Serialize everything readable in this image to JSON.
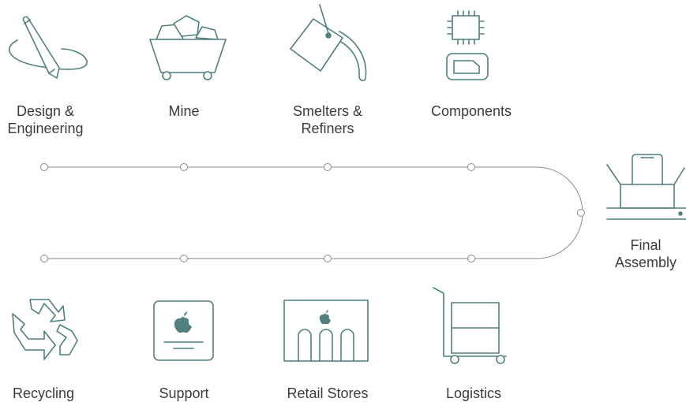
{
  "colors": {
    "icon_stroke": "#4f7f7f",
    "icon_fill": "#ffffff",
    "line": "#8a8a8a",
    "node_fill": "#ffffff",
    "text": "#3b3b3b"
  },
  "stages": {
    "design": {
      "line1": "Design &",
      "line2": "Engineering",
      "icon": "pencil-icon"
    },
    "mine": {
      "label": "Mine",
      "icon": "mine-cart-icon"
    },
    "smelters": {
      "line1": "Smelters &",
      "line2": "Refiners",
      "icon": "crucible-icon"
    },
    "components": {
      "label": "Components",
      "icon": "chip-icon"
    },
    "final": {
      "line1": "Final",
      "line2": "Assembly",
      "icon": "assembly-box-icon"
    },
    "recycling": {
      "label": "Recycling",
      "icon": "recycle-icon"
    },
    "support": {
      "label": "Support",
      "icon": "support-device-icon"
    },
    "retail": {
      "label": "Retail Stores",
      "icon": "store-icon"
    },
    "logistics": {
      "label": "Logistics",
      "icon": "hand-truck-icon"
    }
  }
}
